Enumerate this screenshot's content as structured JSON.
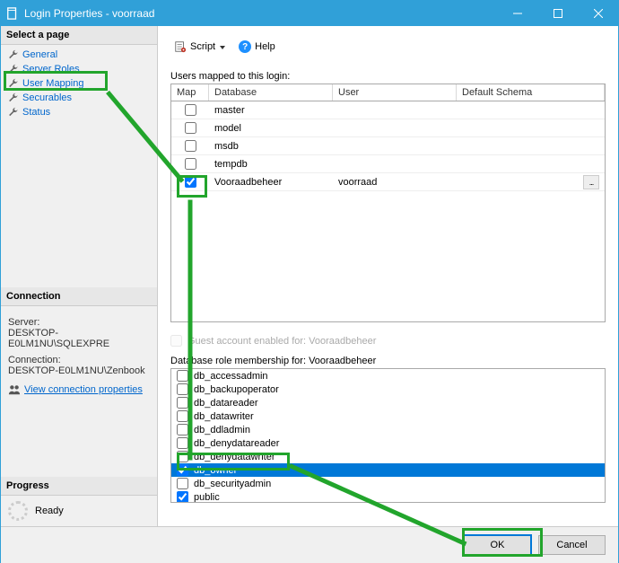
{
  "window": {
    "title": "Login Properties - voorraad"
  },
  "sidebar": {
    "select_page_hdr": "Select a page",
    "items": [
      {
        "label": "General"
      },
      {
        "label": "Server Roles"
      },
      {
        "label": "User Mapping"
      },
      {
        "label": "Securables"
      },
      {
        "label": "Status"
      }
    ],
    "connection_hdr": "Connection",
    "server_label": "Server:",
    "server_value": "DESKTOP-E0LM1NU\\SQLEXPRE",
    "connection_label": "Connection:",
    "connection_value": "DESKTOP-E0LM1NU\\Zenbook",
    "vcp_label": "View connection properties",
    "progress_hdr": "Progress",
    "progress_status": "Ready"
  },
  "toolbar": {
    "script_label": "Script",
    "help_label": "Help"
  },
  "mapping": {
    "label": "Users mapped to this login:",
    "headers": {
      "map": "Map",
      "database": "Database",
      "user": "User",
      "schema": "Default Schema"
    },
    "rows": [
      {
        "checked": false,
        "database": "master",
        "user": "",
        "schema_btn": false
      },
      {
        "checked": false,
        "database": "model",
        "user": "",
        "schema_btn": false
      },
      {
        "checked": false,
        "database": "msdb",
        "user": "",
        "schema_btn": false
      },
      {
        "checked": false,
        "database": "tempdb",
        "user": "",
        "schema_btn": false
      },
      {
        "checked": true,
        "database": "Vooraadbeheer",
        "user": "voorraad",
        "schema_btn": true
      }
    ]
  },
  "guest": {
    "label": "Guest account enabled for: Vooraadbeheer"
  },
  "roles": {
    "label": "Database role membership for: Vooraadbeheer",
    "items": [
      {
        "checked": false,
        "name": "db_accessadmin"
      },
      {
        "checked": false,
        "name": "db_backupoperator"
      },
      {
        "checked": false,
        "name": "db_datareader"
      },
      {
        "checked": false,
        "name": "db_datawriter"
      },
      {
        "checked": false,
        "name": "db_ddladmin"
      },
      {
        "checked": false,
        "name": "db_denydatareader"
      },
      {
        "checked": false,
        "name": "db_denydatawriter"
      },
      {
        "checked": true,
        "name": "db_owner",
        "selected": true
      },
      {
        "checked": false,
        "name": "db_securityadmin"
      },
      {
        "checked": true,
        "name": "public"
      }
    ]
  },
  "footer": {
    "ok": "OK",
    "cancel": "Cancel"
  }
}
